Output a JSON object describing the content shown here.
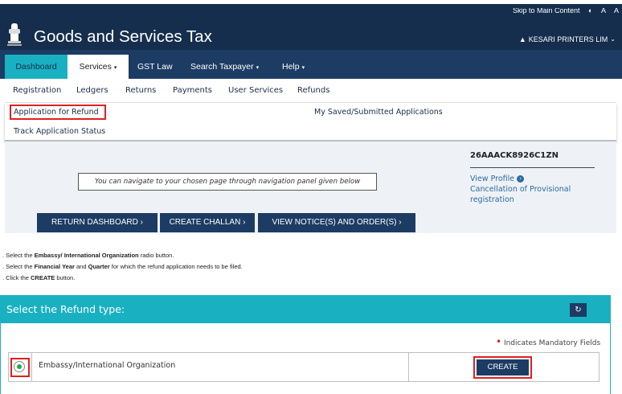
{
  "header": {
    "skip_link": "Skip to Main Content",
    "font_controls": [
      "A",
      "A"
    ],
    "contrast_icon": "contrast-icon",
    "site_title": "Goods and Services Tax",
    "user_name": "KESARI PRINTERS LIM",
    "user_icon": "user-icon",
    "colors": {
      "header_bg": "#152e4d",
      "nav_bg": "#1c3c64",
      "accent": "#19b1c2"
    }
  },
  "main_nav": {
    "items": [
      {
        "label": "Dashboard"
      },
      {
        "label": "Services",
        "caret": "▾"
      },
      {
        "label": "GST Law"
      },
      {
        "label": "Search Taxpayer",
        "caret": "▾"
      },
      {
        "label": "Help",
        "caret": "▾"
      }
    ]
  },
  "sub_nav": {
    "items": [
      "Registration",
      "Ledgers",
      "Returns",
      "Payments",
      "User Services",
      "Refunds"
    ]
  },
  "refunds_menu": {
    "application_for_refund": "Application for Refund",
    "track_status": "Track Application Status",
    "saved_submitted": "My Saved/Submitted Applications"
  },
  "dashboard": {
    "notice": "You can navigate to your chosen page through navigation panel given below",
    "gstin": "26AAACK8926C1ZN",
    "view_profile": "View Profile",
    "cancellation_line1": "Cancellation of Provisional",
    "cancellation_line2": "registration",
    "buttons": {
      "return_dashboard": "RETURN DASHBOARD ›",
      "create_challan": "CREATE CHALLAN ›",
      "view_notices": "VIEW NOTICE(S) AND ORDER(S) ›"
    }
  },
  "instructions": [
    {
      "prefix": ". Select the ",
      "bold": "Embassy/ International Organization",
      "suffix": " radio button."
    },
    {
      "prefix": ". Select the ",
      "bold": "Financial Year",
      "middle": " and ",
      "bold2": "Quarter",
      "suffix": " for which the refund application needs to be filed."
    },
    {
      "prefix": ". Click the ",
      "bold": "CREATE",
      "suffix": " button."
    }
  ],
  "refund_panel": {
    "title": "Select the Refund type:",
    "refresh_icon": "refresh-icon",
    "mandatory_note": "Indicates Mandatory Fields",
    "option_label": "Embassy/International Organization",
    "option_selected": true,
    "create_label": "CREATE"
  }
}
